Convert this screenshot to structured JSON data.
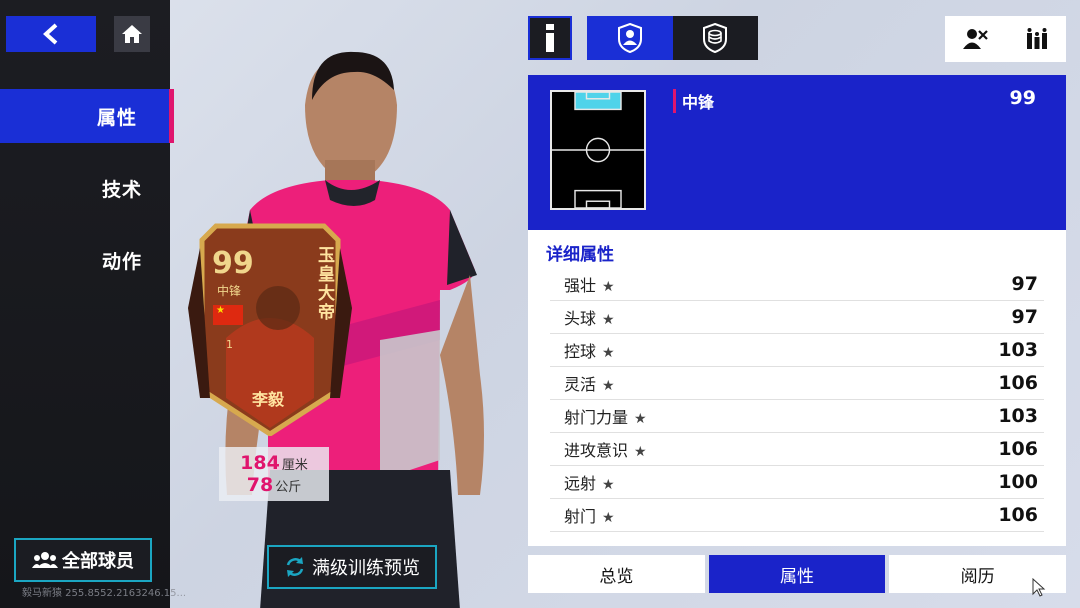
{
  "sidebar": {
    "items": [
      {
        "label": "属性",
        "active": true
      },
      {
        "label": "技术",
        "active": false
      },
      {
        "label": "动作",
        "active": false
      }
    ],
    "all_players_label": "全部球员",
    "watermark": "毅马新猿 255.8552.2163246.15..."
  },
  "card": {
    "rating": "99",
    "position": "中锋",
    "title": "玉皇大帝",
    "number": "1",
    "name": "李毅",
    "nationality": "China"
  },
  "body": {
    "height": "184",
    "height_unit": "厘米",
    "weight": "78",
    "weight_unit": "公斤"
  },
  "train_preview_label": "满级训练预览",
  "position_panel": {
    "position": "中锋",
    "value": "99"
  },
  "attributes": {
    "title": "详细属性",
    "rows": [
      {
        "name": "强壮",
        "value": "97"
      },
      {
        "name": "头球",
        "value": "97"
      },
      {
        "name": "控球",
        "value": "103"
      },
      {
        "name": "灵活",
        "value": "106"
      },
      {
        "name": "射门力量",
        "value": "103"
      },
      {
        "name": "进攻意识",
        "value": "106"
      },
      {
        "name": "远射",
        "value": "100"
      },
      {
        "name": "射门",
        "value": "106"
      }
    ]
  },
  "bottom_tabs": [
    {
      "label": "总览",
      "active": false
    },
    {
      "label": "属性",
      "active": true
    },
    {
      "label": "阅历",
      "active": false
    }
  ],
  "colors": {
    "accent_blue": "#1a2fd6",
    "panel_blue": "#1a23c9",
    "accent_pink": "#e0156d",
    "outline_cyan": "#1ba6c2"
  }
}
